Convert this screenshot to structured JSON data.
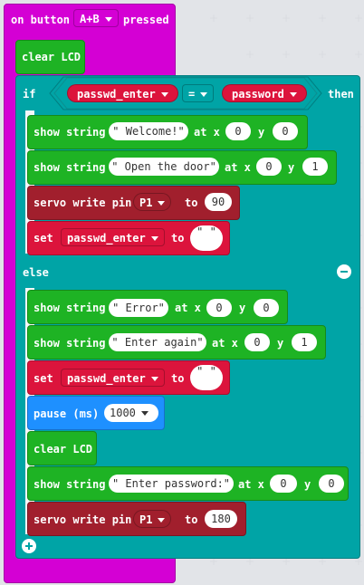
{
  "colors": {
    "event": "#d400d4",
    "basic": "#1eb324",
    "logic": "#00a4a6",
    "variable": "#dc143c",
    "servo": "#a11f2d",
    "pause": "#1e90ff"
  },
  "event": {
    "prefix": "on button",
    "button": "A+B",
    "suffix": "pressed"
  },
  "clear1": "clear LCD",
  "if": {
    "label": "if",
    "left_var": "passwd_enter",
    "op": "=",
    "right_var": "password",
    "then": "then"
  },
  "show1": {
    "label": "show string",
    "text": "Welcome!",
    "at_x": "at x",
    "x": "0",
    "y_label": "y",
    "y": "0"
  },
  "show2": {
    "label": "show string",
    "text": "Open the door",
    "at_x": "at x",
    "x": "0",
    "y_label": "y",
    "y": "1"
  },
  "servo1": {
    "label": "servo write pin",
    "pin": "P1",
    "to": "to",
    "value": "90"
  },
  "set1": {
    "label": "set",
    "var": "passwd_enter",
    "to": "to",
    "value": ""
  },
  "else": "else",
  "show3": {
    "label": "show string",
    "text": "Error",
    "at_x": "at x",
    "x": "0",
    "y_label": "y",
    "y": "0"
  },
  "show4": {
    "label": "show string",
    "text": "Enter again",
    "at_x": "at x",
    "x": "0",
    "y_label": "y",
    "y": "1"
  },
  "set2": {
    "label": "set",
    "var": "passwd_enter",
    "to": "to",
    "value": ""
  },
  "pause": {
    "label": "pause (ms)",
    "value": "1000"
  },
  "clear2": "clear LCD",
  "show5": {
    "label": "show string",
    "text": "Enter password:",
    "at_x": "at x",
    "x": "0",
    "y_label": "y",
    "y": "0"
  },
  "servo2": {
    "label": "servo write pin",
    "pin": "P1",
    "to": "to",
    "value": "180"
  },
  "quote": "\""
}
